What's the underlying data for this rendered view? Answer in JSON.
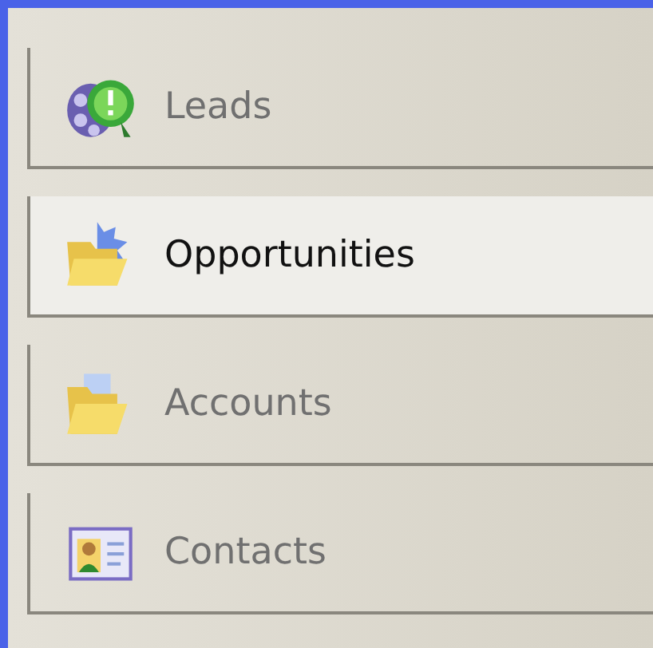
{
  "nav_items": [
    {
      "label": "Leads",
      "kind": "people",
      "selected": false
    },
    {
      "label": "Opportunities",
      "kind": "folder-gear",
      "selected": true
    },
    {
      "label": "Accounts",
      "kind": "folder",
      "selected": false
    },
    {
      "label": "Contacts",
      "kind": "card",
      "selected": false
    }
  ]
}
